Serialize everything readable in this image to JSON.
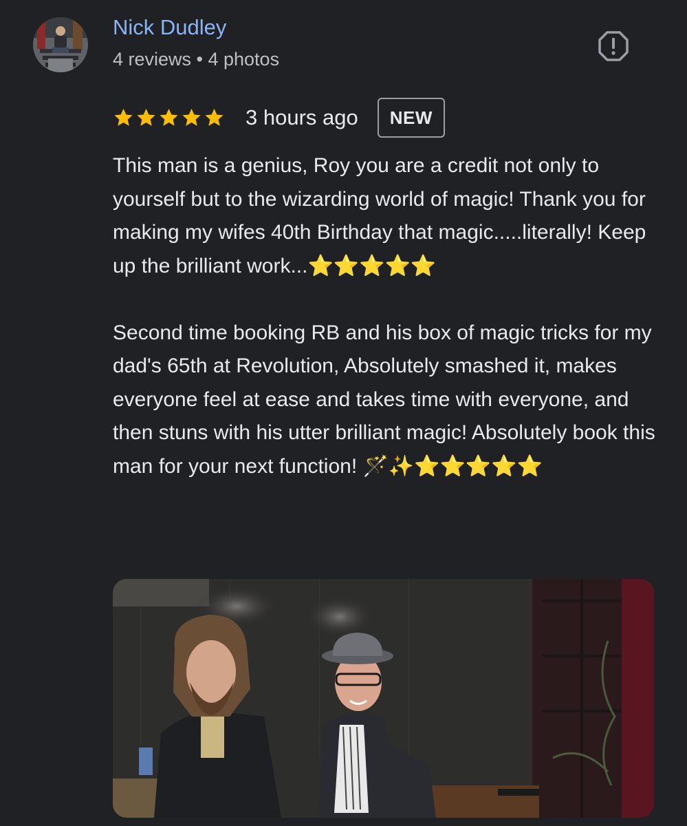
{
  "review": {
    "author": {
      "name": "Nick Dudley",
      "meta": "4 reviews • 4 photos",
      "avatar_icon": "avatar-photo"
    },
    "report_icon": "report-flag-icon",
    "rating": 5,
    "rating_max": 5,
    "star_color": "#fbbc04",
    "time": "3 hours ago",
    "badge": "NEW",
    "paragraphs": [
      "This man is a genius, Roy you are a credit not only to yourself but to the wizarding world of magic! Thank you for making my wifes 40th Birthday that magic.....literally! Keep up the brilliant work...⭐⭐⭐⭐⭐",
      "Second time booking RB and his box of magic tricks for my dad's 65th at Revolution, Absolutely smashed it, makes everyone feel at ease and takes time with everyone, and then stuns with his utter brilliant magic! Absolutely book this man for your next function! 🪄✨⭐⭐⭐⭐⭐"
    ],
    "photo_icon": "review-photo"
  },
  "colors": {
    "background": "#202124",
    "author_link": "#8ab4f8",
    "secondary_text": "#bdc1c6",
    "primary_text": "#e8eaed"
  }
}
